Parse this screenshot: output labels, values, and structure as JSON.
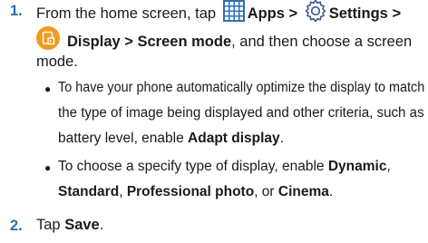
{
  "steps": [
    {
      "number": "1.",
      "lead": "From the home screen, tap",
      "apps_label": "Apps",
      "sep1": ">",
      "settings_label": "Settings",
      "sep2": ">",
      "display_path": "Display > Screen mode",
      "tail1": ", and then choose a screen",
      "tail2": "mode.",
      "bullets": [
        {
          "line1": "To have your phone automatically optimize the display to match",
          "line2": "the type of image being displayed and other criteria, such as",
          "line3_pre": "battery level, enable ",
          "line3_bold": "Adapt display",
          "line3_post": "."
        },
        {
          "line1_pre": "To choose a specify type of display, enable ",
          "line1_bold": "Dynamic",
          "line1_post": ",",
          "line2_bold1": "Standard",
          "line2_sep1": ", ",
          "line2_bold2": "Professional photo",
          "line2_sep2": ", or ",
          "line2_bold3": "Cinema",
          "line2_post": "."
        }
      ]
    },
    {
      "number": "2.",
      "lead": "Tap ",
      "save_label": "Save",
      "tail": "."
    }
  ],
  "icons": {
    "apps": "apps-grid-icon",
    "settings": "settings-gear-icon",
    "display": "display-settings-icon",
    "apps_color": "#2f6fb0",
    "settings_color": "#3a5a8c",
    "display_color": "#f39a1e"
  }
}
